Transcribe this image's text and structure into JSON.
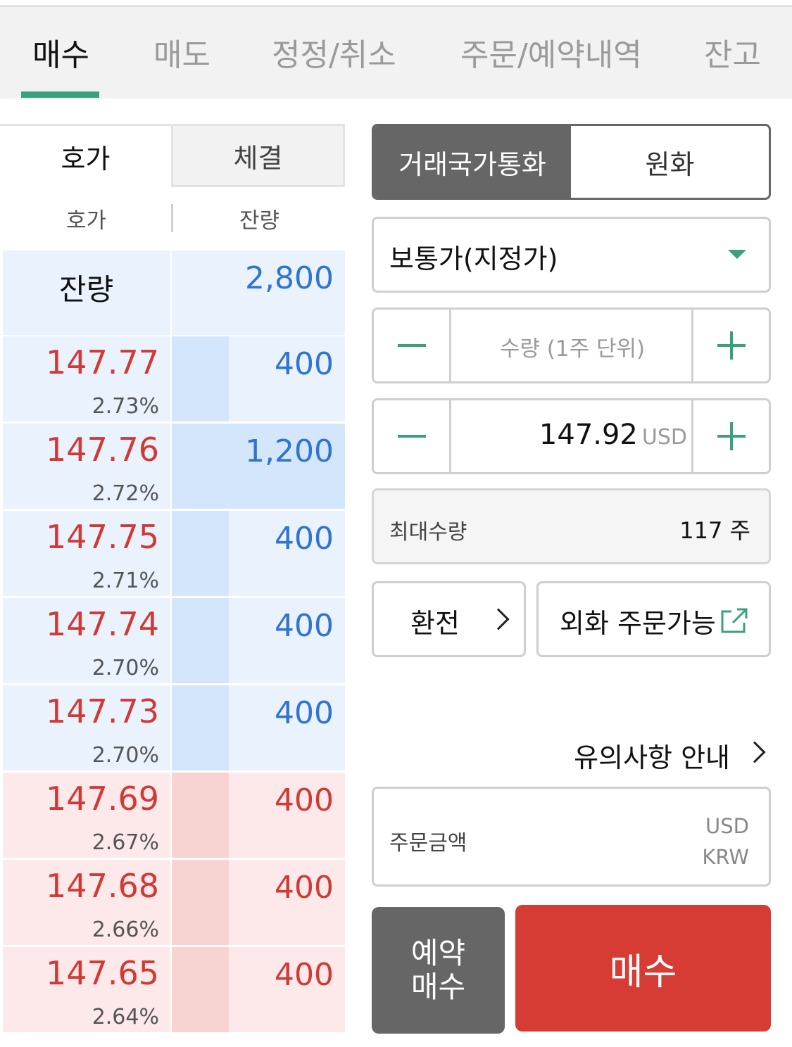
{
  "tabs": [
    {
      "label": "매수",
      "active": true
    },
    {
      "label": "매도",
      "active": false
    },
    {
      "label": "정정/취소",
      "active": false
    },
    {
      "label": "주문/예약내역",
      "active": false
    },
    {
      "label": "잔고",
      "active": false
    }
  ],
  "book": {
    "tab_quote": "호가",
    "tab_trade": "체결",
    "col_quote": "호가",
    "col_remain": "잔량",
    "remain_label": "잔량",
    "remain_total": "2,800",
    "rows": [
      {
        "side": "ask",
        "price": "147.77",
        "pct": "2.73%",
        "qty": "400",
        "fill": 0.33
      },
      {
        "side": "ask",
        "price": "147.76",
        "pct": "2.72%",
        "qty": "1,200",
        "fill": 1.0
      },
      {
        "side": "ask",
        "price": "147.75",
        "pct": "2.71%",
        "qty": "400",
        "fill": 0.33
      },
      {
        "side": "ask",
        "price": "147.74",
        "pct": "2.70%",
        "qty": "400",
        "fill": 0.33
      },
      {
        "side": "ask",
        "price": "147.73",
        "pct": "2.70%",
        "qty": "400",
        "fill": 0.33
      },
      {
        "side": "bid",
        "price": "147.69",
        "pct": "2.67%",
        "qty": "400",
        "fill": 0.33
      },
      {
        "side": "bid",
        "price": "147.68",
        "pct": "2.66%",
        "qty": "400",
        "fill": 0.33
      },
      {
        "side": "bid",
        "price": "147.65",
        "pct": "2.64%",
        "qty": "400",
        "fill": 0.33
      }
    ]
  },
  "currency": {
    "local_label": "거래국가통화",
    "krw_label": "원화",
    "selected": "local"
  },
  "order_type": {
    "value": "보통가(지정가)"
  },
  "quantity": {
    "placeholder": "수량 (1주 단위)"
  },
  "price": {
    "value": "147.92",
    "unit": "USD"
  },
  "max_qty": {
    "label": "최대수량",
    "value": "117 주"
  },
  "exchange_label": "환전",
  "fx_available_label": "외화 주문가능",
  "notice_label": "유의사항 안내",
  "amount": {
    "label": "주문금액",
    "usd": "USD",
    "krw": "KRW"
  },
  "reserve_buy": {
    "line1": "예약",
    "line2": "매수"
  },
  "buy_label": "매수",
  "colors": {
    "accent": "#3aa17e",
    "buy": "#d63c33",
    "ask_qty": "#2f74d0",
    "price": "#cf3a36"
  }
}
